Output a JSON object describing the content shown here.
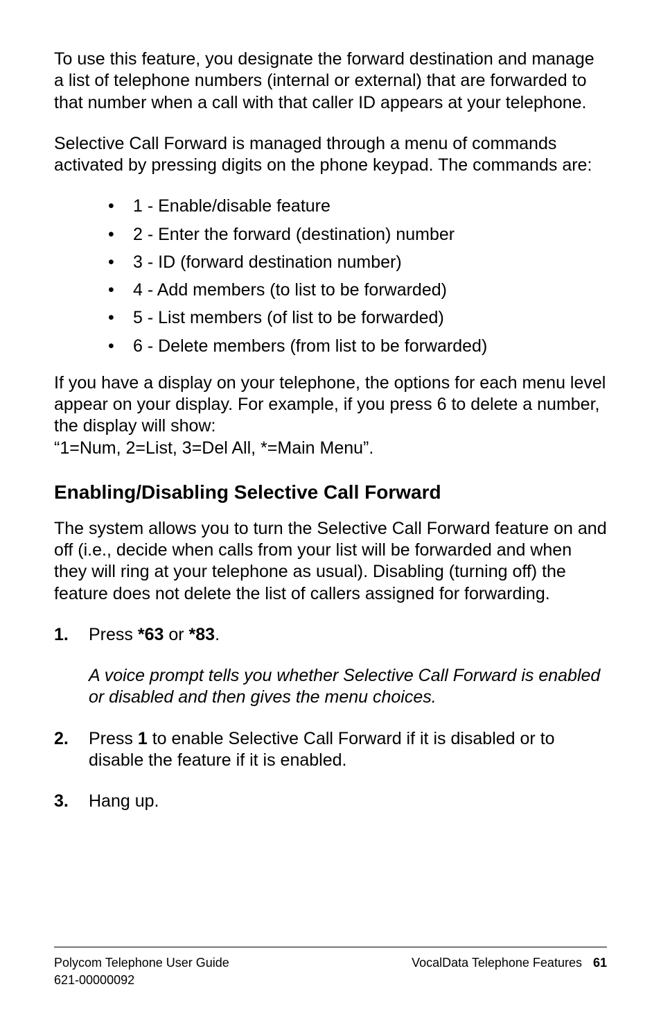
{
  "p1": "To use this feature, you designate the forward destination and manage a list of telephone numbers (internal or external) that are forwarded to that number when a call with that caller ID appears at your telephone.",
  "p2": "Selective Call Forward is managed through a menu of commands activated by pressing digits on the phone keypad. The commands are:",
  "bullets": [
    "1 - Enable/disable feature",
    "2 - Enter the forward (destination) number",
    "3 - ID (forward destination number)",
    "4 - Add members (to list to be forwarded)",
    "5 - List members (of list to be forwarded)",
    "6 - Delete members (from list to be forwarded)"
  ],
  "p3a": "If you have a display on your telephone, the options for each menu level appear on your display. For example, if you press 6 to delete a number, the display will show:",
  "p3b": "“1=Num, 2=List, 3=Del All, *=Main Menu”.",
  "h2": "Enabling/Disabling Selective Call Forward",
  "p4": "The                   system allows you to turn the Selective Call Forward feature on and off (i.e., decide when calls from your list will be forwarded and when they will ring at your telephone as usual). Disabling (turning off) the feature does not delete the list of callers assigned for forwarding.",
  "steps": {
    "s1": {
      "pre": "Press ",
      "b1": "*63",
      "mid": " or ",
      "b2": "*83",
      "post": ".",
      "sub": "A voice prompt tells you whether Selective Call Forward is enabled or disabled and then gives the menu choices."
    },
    "s2": {
      "pre": "Press ",
      "b1": "1",
      "post": " to enable Selective Call Forward if it is disabled or to disable the feature if it is enabled."
    },
    "s3": {
      "text": "Hang up."
    }
  },
  "footer": {
    "left1": "Polycom Telephone User Guide",
    "left2": "621-00000092",
    "rightLabel": "VocalData Telephone Features",
    "pageNum": "61"
  }
}
